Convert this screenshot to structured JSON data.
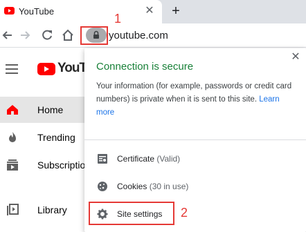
{
  "browser": {
    "tab": {
      "title": "YouTube",
      "close_glyph": "✕"
    },
    "new_tab_glyph": "+",
    "url": "youtube.com"
  },
  "annotations": {
    "first": "1",
    "second": "2",
    "color": "#e53935"
  },
  "youtube": {
    "logo_text": "YouTube",
    "nav": [
      {
        "label": "Home",
        "icon": "home-icon"
      },
      {
        "label": "Trending",
        "icon": "flame-icon"
      },
      {
        "label": "Subscriptions",
        "icon": "subscriptions-icon"
      },
      {
        "label": "Library",
        "icon": "library-icon"
      }
    ]
  },
  "popup": {
    "title": "Connection is secure",
    "description": "Your information (for example, passwords or credit card numbers) is private when it is sent to this site.",
    "learn_more": "Learn more",
    "close_glyph": "✕",
    "rows": [
      {
        "label": "Certificate",
        "sub": "(Valid)",
        "icon": "certificate-icon"
      },
      {
        "label": "Cookies",
        "sub": "(30 in use)",
        "icon": "cookie-icon"
      },
      {
        "label": "Site settings",
        "sub": "",
        "icon": "gear-icon"
      }
    ],
    "secure_color": "#188038",
    "link_color": "#1a73e8"
  }
}
